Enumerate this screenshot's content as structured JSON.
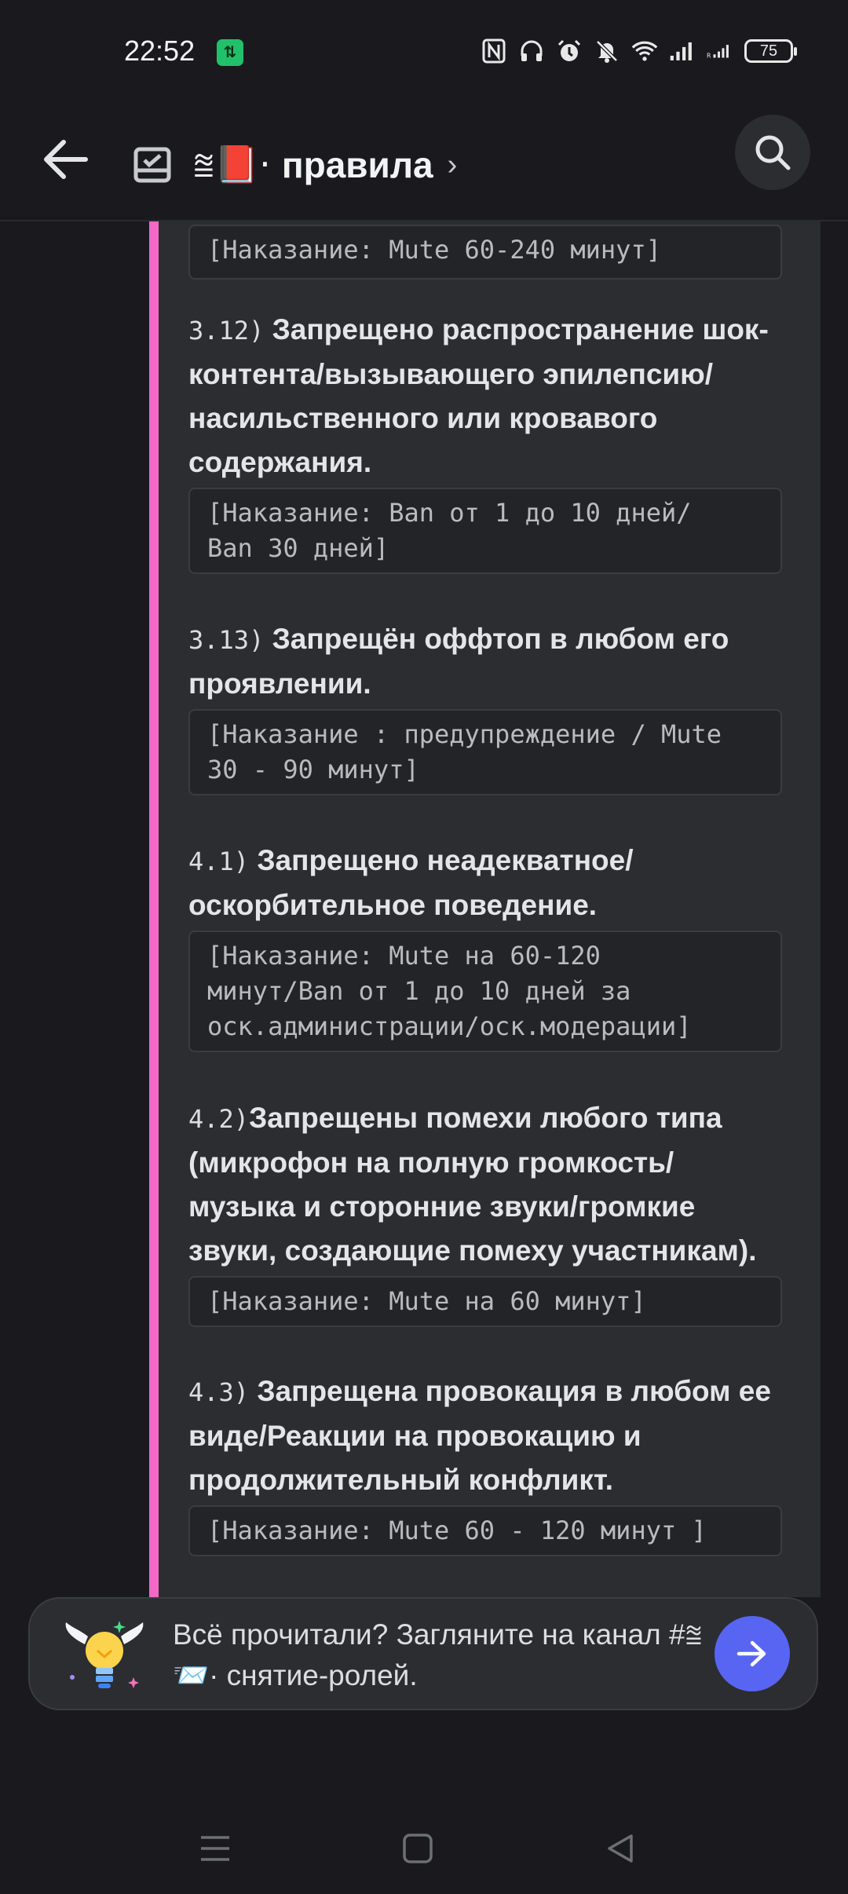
{
  "status_bar": {
    "time": "22:52",
    "data_badge": "⇅",
    "battery": "75",
    "icons": [
      "nfc-icon",
      "headphones-icon",
      "alarm-icon",
      "mute-icon",
      "wifi-icon",
      "signal-icon",
      "signal-roaming-icon",
      "battery-icon"
    ]
  },
  "header": {
    "channel_prefix": "⩰📕·",
    "channel_name": "правила",
    "chevron": "›"
  },
  "messages": [
    {
      "punishment": "[Наказание: Mute 60-240 минут]"
    },
    {
      "number": "3.12)",
      "text": "Запрещено распространение шок-контента/вызывающего эпилепсию/насильственного или кровавого содержания.",
      "punishment": "[Наказание: Ban от 1 до 10 дней/\nBan 30 дней]"
    },
    {
      "number": "3.13)",
      "text": "Запрещён оффтоп в любом его проявлении.",
      "punishment": "[Наказание : предупреждение / Mute\n30 - 90 минут]"
    },
    {
      "number": "4.1)",
      "text": "Запрещено неадекватное/ оскорбительное поведение.",
      "punishment": "[Наказание: Mute на 60-120\nминут/Ban от 1 до 10 дней за\nоск.администрации/оск.модерации]"
    },
    {
      "number": "4.2)",
      "text": "Запрещены помехи любого типа (микрофон на полную громкость/ музыка и сторонние звуки/громкие звуки, создающие помеху участникам).",
      "punishment": "[Наказание: Mute на 60 минут]"
    },
    {
      "number": "4.3)",
      "text": "Запрещена провокация в любом ее виде/Реакции на провокацию и продолжительный конфликт.",
      "punishment": "[Наказание: Mute 60 - 120 минут ]"
    }
  ],
  "banner": {
    "text": "Всё прочитали? Загляните на канал #⩰📨· снятие-ролей."
  },
  "colors": {
    "accent": "#f368c4",
    "button": "#5865f2",
    "background": "#1a1a1e",
    "embed": "#2b2d31"
  }
}
